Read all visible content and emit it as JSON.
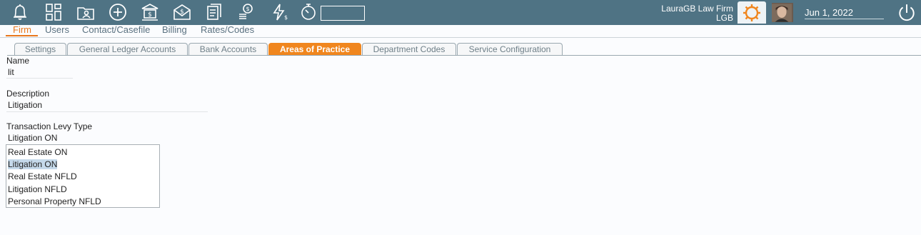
{
  "topbar": {
    "icons": [
      "bell-icon",
      "dashboard-icon",
      "folder-user-icon",
      "add-icon",
      "bank-icon",
      "envelope-dollar-icon",
      "documents-icon",
      "coins-icon",
      "lightning-icon",
      "stopwatch-icon"
    ],
    "timer_value": "",
    "firm_name": "LauraGB Law Firm",
    "firm_code": "LGB",
    "date": "Jun 1, 2022",
    "accent": "#f0861e",
    "bar_color": "#4f7384"
  },
  "nav": {
    "items": [
      "Firm",
      "Users",
      "Contact/Casefile",
      "Billing",
      "Rates/Codes"
    ],
    "active": "Firm"
  },
  "tabs": {
    "items": [
      "Settings",
      "General Ledger Accounts",
      "Bank Accounts",
      "Areas of Practice",
      "Department Codes",
      "Service Configuration"
    ],
    "active": "Areas of Practice"
  },
  "form": {
    "name_label": "Name",
    "name_value": "lit",
    "description_label": "Description",
    "description_value": "Litigation",
    "levy_label": "Transaction Levy Type",
    "levy_value": "Litigation ON",
    "levy_options": [
      "Real Estate ON",
      "Litigation ON",
      "Real Estate NFLD",
      "Litigation NFLD",
      "Personal Property NFLD"
    ],
    "levy_selected": "Litigation ON"
  }
}
